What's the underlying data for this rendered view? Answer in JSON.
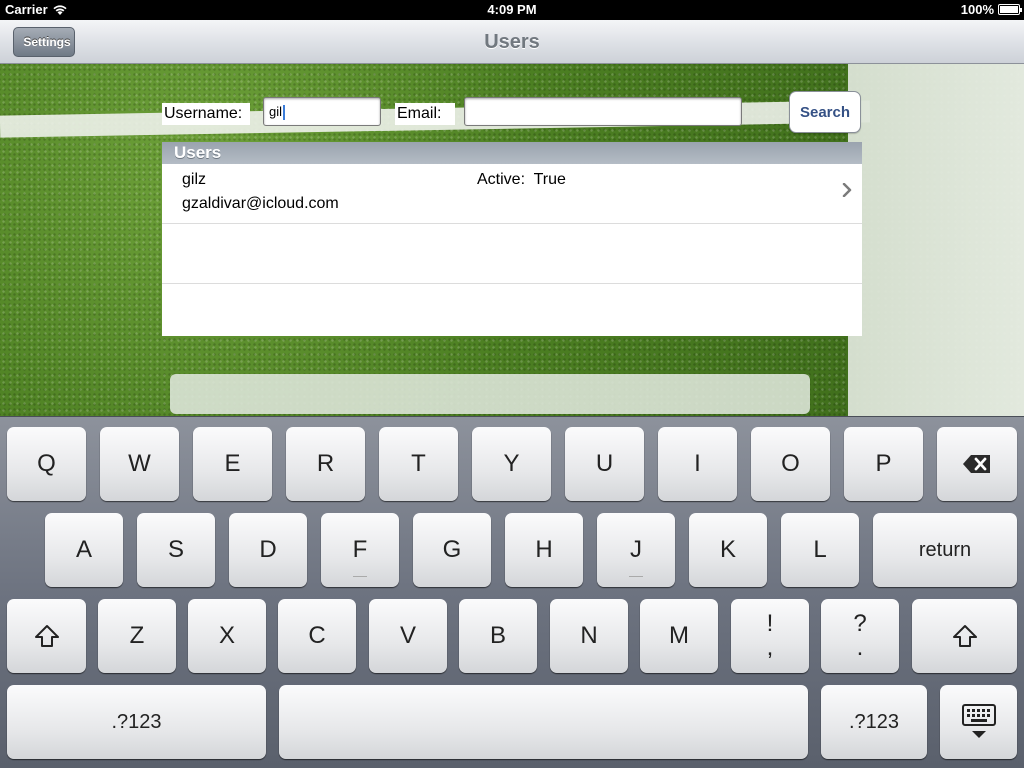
{
  "status_bar": {
    "carrier": "Carrier",
    "time": "4:09 PM",
    "battery": "100%"
  },
  "nav_bar": {
    "back_label": "Settings",
    "title": "Users"
  },
  "search_form": {
    "username_label": "Username:",
    "username_value": "gil",
    "email_label": "Email:",
    "email_value": "",
    "search_label": "Search"
  },
  "users_table": {
    "header": "Users",
    "rows": [
      {
        "username": "gilz",
        "email": "gzaldivar@icloud.com",
        "active": "Active:  True"
      }
    ]
  },
  "keyboard": {
    "row1": [
      "Q",
      "W",
      "E",
      "R",
      "T",
      "Y",
      "U",
      "I",
      "O",
      "P"
    ],
    "row2": [
      "A",
      "S",
      "D",
      "F",
      "G",
      "H",
      "J",
      "K",
      "L"
    ],
    "return_label": "return",
    "row3": [
      "Z",
      "X",
      "C",
      "V",
      "B",
      "N",
      "M"
    ],
    "punct1": [
      "!",
      ","
    ],
    "punct2": [
      "?",
      "."
    ],
    "numbers_label": ".?123"
  }
}
